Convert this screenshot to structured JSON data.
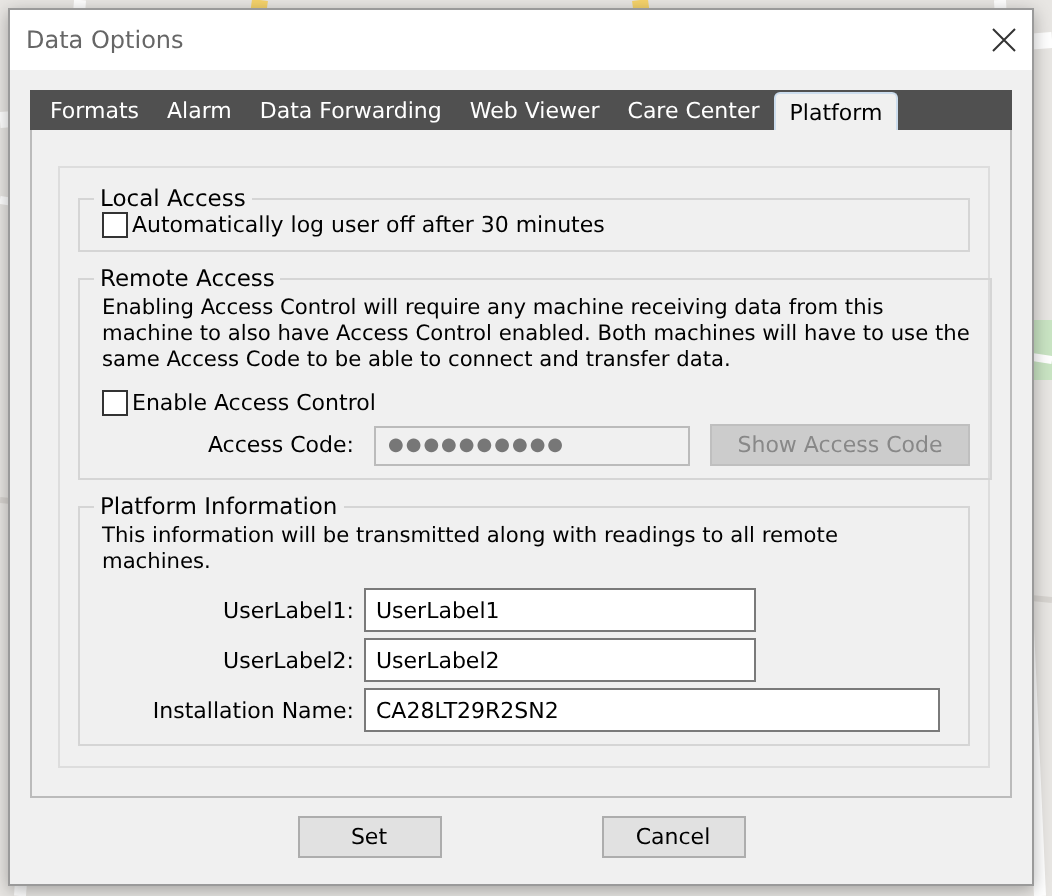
{
  "window": {
    "title": "Data Options"
  },
  "tabs": [
    {
      "label": "Formats",
      "selected": false
    },
    {
      "label": "Alarm",
      "selected": false
    },
    {
      "label": "Data Forwarding",
      "selected": false
    },
    {
      "label": "Web Viewer",
      "selected": false
    },
    {
      "label": "Care Center",
      "selected": false
    },
    {
      "label": "Platform",
      "selected": true
    }
  ],
  "local_access": {
    "title": "Local Access",
    "checkbox": {
      "label": "Automatically log user off after 30 minutes",
      "checked": false
    }
  },
  "remote_access": {
    "title": "Remote Access",
    "description": "Enabling Access Control will require any machine receiving data from this machine to also have Access Control enabled. Both machines will have to use the same Access Code to be able to connect and transfer data.",
    "checkbox": {
      "label": "Enable Access Control",
      "checked": false
    },
    "access_code": {
      "label": "Access Code:",
      "value": "●●●●●●●●●●",
      "disabled": true
    },
    "show_button": {
      "label": "Show Access Code",
      "disabled": true
    }
  },
  "platform_info": {
    "title": "Platform Information",
    "description": "This information will be transmitted along with readings to all remote machines.",
    "fields": [
      {
        "label": "UserLabel1:",
        "value": "UserLabel1"
      },
      {
        "label": "UserLabel2:",
        "value": "UserLabel2"
      },
      {
        "label": "Installation Name:",
        "value": "CA28LT29R2SN2"
      }
    ]
  },
  "buttons": [
    {
      "label": "Set"
    },
    {
      "label": "Cancel"
    }
  ]
}
